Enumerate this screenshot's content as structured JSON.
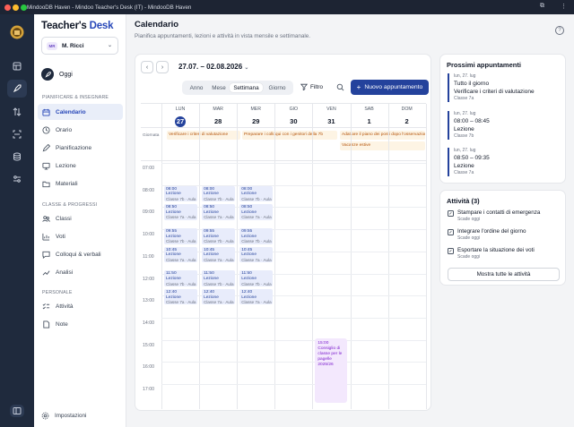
{
  "window": {
    "title": "MindooDB Haven - Mindoo Teacher's Desk (IT) - MindooDB Haven"
  },
  "brand": {
    "part1": "Teacher's ",
    "part2": "Desk"
  },
  "user": {
    "initials": "MR",
    "name": "M. Ricci"
  },
  "nav": {
    "oggi": "Oggi",
    "section_planning": "PIANIFICARE & INSEGNARE",
    "planning": [
      "Calendario",
      "Orario",
      "Pianificazione",
      "Lezione",
      "Materiali"
    ],
    "section_classes": "CLASSE & PROGRESSI",
    "classes": [
      "Classi",
      "Voti",
      "Colloqui & verbali",
      "Analisi"
    ],
    "section_personal": "PERSONALE",
    "personal": [
      "Attività",
      "Note"
    ],
    "settings": "Impostazioni"
  },
  "page": {
    "title": "Calendario",
    "subtitle": "Pianifica appuntamenti, lezioni e attività in vista mensile e settimanale."
  },
  "calendar": {
    "range": "27.07. – 02.08.2026",
    "views": [
      "Anno",
      "Mese",
      "Settimana",
      "Giorno"
    ],
    "active_view": "Settimana",
    "filter": "Filtro",
    "new_button": "Nuovo appuntamento",
    "allday_label": "Giornata",
    "days": [
      {
        "name": "LUN",
        "num": "27",
        "today": true
      },
      {
        "name": "MAR",
        "num": "28"
      },
      {
        "name": "MER",
        "num": "29"
      },
      {
        "name": "GIO",
        "num": "30"
      },
      {
        "name": "VEN",
        "num": "31"
      },
      {
        "name": "SAB",
        "num": "1"
      },
      {
        "name": "DOM",
        "num": "2"
      }
    ],
    "hours": [
      "07:00",
      "08:00",
      "09:00",
      "10:00",
      "11:00",
      "12:00",
      "13:00",
      "14:00",
      "15:00",
      "16:00",
      "17:00"
    ],
    "allday_events": [
      "Verificare i criteri di valutazione",
      "Preparare i colloqui con i genitori della 7b",
      "Adattare il piano dei posti dopo l'osservazione",
      "Vacanze estive"
    ],
    "lesson_label": "Lezione",
    "lessons": [
      {
        "time": "08:00",
        "class": "Classe 7b · Aula 12"
      },
      {
        "time": "08:50",
        "class": "Classe 7a · Aula 12"
      },
      {
        "time": "09:55",
        "class": "Classe 7b · Aula 12"
      },
      {
        "time": "10:45",
        "class": "Classe 7a · Aula 12"
      },
      {
        "time": "11:50",
        "class": "Classe 7b · Aula 12"
      },
      {
        "time": "12:40",
        "class": "Classe 7a · Aula 12"
      }
    ],
    "special_event": {
      "time": "15:00",
      "title": "Consiglio di classe per le pagelle 2025/26"
    }
  },
  "upcoming": {
    "title": "Prossimi appuntamenti",
    "items": [
      {
        "date": "lun, 27. lug",
        "time": "Tutto il giorno",
        "title": "Verificare i criteri di valutazione",
        "class": "Classe 7a"
      },
      {
        "date": "lun, 27. lug",
        "time": "08:00 – 08:45",
        "title": "Lezione",
        "class": "Classe 7b"
      },
      {
        "date": "lun, 27. lug",
        "time": "08:50 – 09:35",
        "title": "Lezione",
        "class": "Classe 7a"
      }
    ]
  },
  "activities": {
    "title": "Attività (3)",
    "items": [
      {
        "text": "Stampare i contatti di emergenza",
        "due": "Scade oggi"
      },
      {
        "text": "Integrare l'ordine del giorno",
        "due": "Scade oggi"
      },
      {
        "text": "Esportare la situazione dei voti",
        "due": "Scade oggi"
      }
    ],
    "show_all": "Mostra tutte le attività"
  }
}
